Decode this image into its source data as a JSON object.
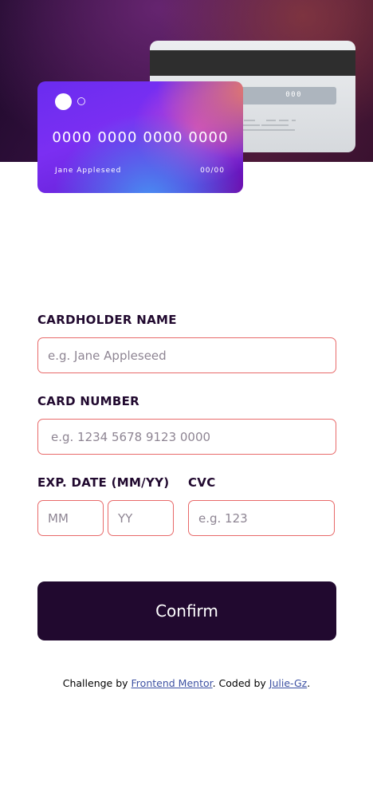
{
  "card_preview": {
    "front": {
      "number": "0000 0000 0000 0000",
      "holder": "Jane Appleseed",
      "expiry": "00/00"
    },
    "back": {
      "cvc": "000"
    }
  },
  "form": {
    "cardholder": {
      "label": "CARDHOLDER NAME",
      "placeholder": "e.g. Jane Appleseed"
    },
    "card_number": {
      "label": "CARD NUMBER",
      "placeholder": "e.g. 1234 5678 9123 0000"
    },
    "expiry": {
      "label": "EXP. DATE (MM/YY)",
      "month_placeholder": "MM",
      "year_placeholder": "YY"
    },
    "cvc": {
      "label": "CVC",
      "placeholder": "e.g. 123"
    },
    "confirm_label": "Confirm"
  },
  "footer": {
    "prefix": "Challenge by ",
    "link1": "Frontend Mentor",
    "middle": ". Coded by ",
    "link2": "Julie-Gz",
    "suffix": "."
  },
  "colors": {
    "dark": "#21092f",
    "input_border": "#e86a6a",
    "link": "#3e52a3"
  }
}
